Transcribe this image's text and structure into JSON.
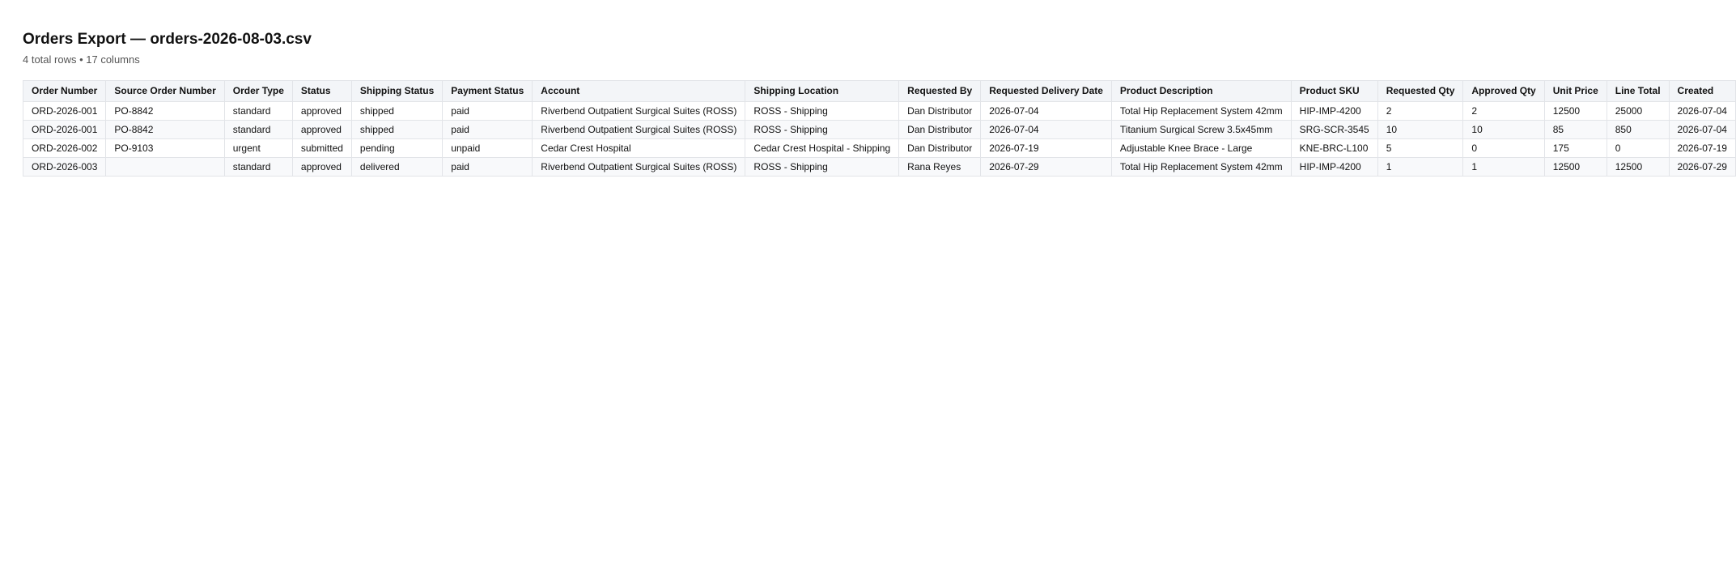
{
  "header": {
    "title": "Orders Export — orders-2026-08-03.csv",
    "subtitle": "4 total rows • 17 columns"
  },
  "table": {
    "columns": [
      "Order Number",
      "Source Order Number",
      "Order Type",
      "Status",
      "Shipping Status",
      "Payment Status",
      "Account",
      "Shipping Location",
      "Requested By",
      "Requested Delivery Date",
      "Product Description",
      "Product SKU",
      "Requested Qty",
      "Approved Qty",
      "Unit Price",
      "Line Total",
      "Created"
    ],
    "rows": [
      [
        "ORD-2026-001",
        "PO-8842",
        "standard",
        "approved",
        "shipped",
        "paid",
        "Riverbend Outpatient Surgical Suites (ROSS)",
        "ROSS - Shipping",
        "Dan Distributor",
        "2026-07-04",
        "Total Hip Replacement System 42mm",
        "HIP-IMP-4200",
        "2",
        "2",
        "12500",
        "25000",
        "2026-07-04"
      ],
      [
        "ORD-2026-001",
        "PO-8842",
        "standard",
        "approved",
        "shipped",
        "paid",
        "Riverbend Outpatient Surgical Suites (ROSS)",
        "ROSS - Shipping",
        "Dan Distributor",
        "2026-07-04",
        "Titanium Surgical Screw 3.5x45mm",
        "SRG-SCR-3545",
        "10",
        "10",
        "85",
        "850",
        "2026-07-04"
      ],
      [
        "ORD-2026-002",
        "PO-9103",
        "urgent",
        "submitted",
        "pending",
        "unpaid",
        "Cedar Crest Hospital",
        "Cedar Crest Hospital - Shipping",
        "Dan Distributor",
        "2026-07-19",
        "Adjustable Knee Brace - Large",
        "KNE-BRC-L100",
        "5",
        "0",
        "175",
        "0",
        "2026-07-19"
      ],
      [
        "ORD-2026-003",
        "",
        "standard",
        "approved",
        "delivered",
        "paid",
        "Riverbend Outpatient Surgical Suites (ROSS)",
        "ROSS - Shipping",
        "Rana Reyes",
        "2026-07-29",
        "Total Hip Replacement System 42mm",
        "HIP-IMP-4200",
        "1",
        "1",
        "12500",
        "12500",
        "2026-07-29"
      ]
    ]
  }
}
